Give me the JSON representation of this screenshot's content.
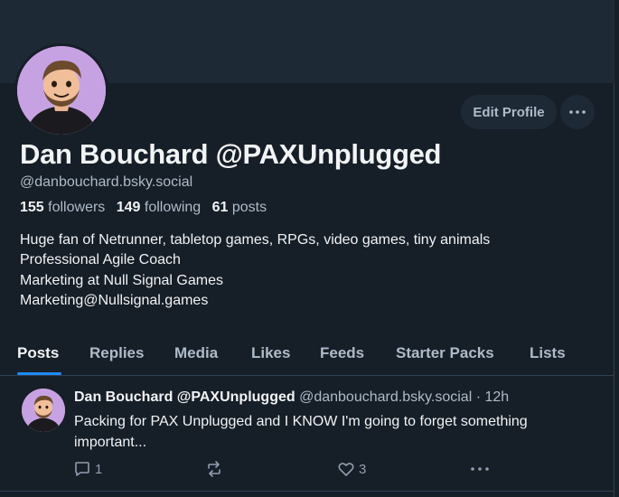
{
  "profile": {
    "display_name": "Dan Bouchard @PAXUnplugged",
    "handle": "@danbouchard.bsky.social",
    "followers_count": "155",
    "followers_label": "followers",
    "following_count": "149",
    "following_label": "following",
    "posts_count": "61",
    "posts_label": "posts",
    "bio_lines": [
      "Huge fan of Netrunner, tabletop games, RPGs, video games, tiny animals",
      "Professional Agile Coach",
      "Marketing at Null Signal Games",
      "Marketing@Nullsignal.games"
    ],
    "edit_profile_label": "Edit Profile",
    "more_icon": "ellipsis-icon"
  },
  "tabs": [
    {
      "label": "Posts",
      "active": true
    },
    {
      "label": "Replies",
      "active": false
    },
    {
      "label": "Media",
      "active": false
    },
    {
      "label": "Likes",
      "active": false
    },
    {
      "label": "Feeds",
      "active": false
    },
    {
      "label": "Starter Packs",
      "active": false
    },
    {
      "label": "Lists",
      "active": false
    }
  ],
  "post": {
    "author_name": "Dan Bouchard @PAXUnplugged",
    "author_handle": "@danbouchard.bsky.social",
    "separator": " · ",
    "time": "12h",
    "text": "Packing for PAX Unplugged and I KNOW I'm going to forget something important...",
    "reply_count": "1",
    "repost_count": "",
    "like_count": "3"
  },
  "colors": {
    "background": "#161e27",
    "banner": "#1e2936",
    "accent": "#208bfe",
    "muted_text": "#aebbc9"
  }
}
